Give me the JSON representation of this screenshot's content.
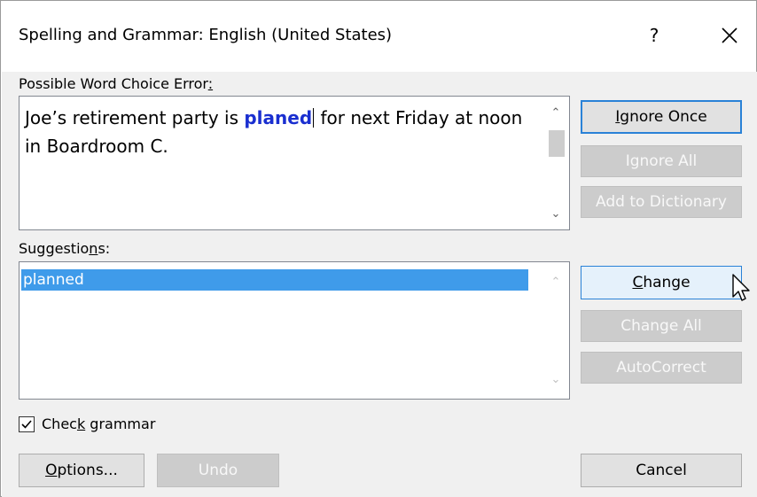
{
  "dialog": {
    "title": "Spelling and Grammar: English (United States)",
    "help_label": "?",
    "close_icon": "close-icon"
  },
  "error_section": {
    "label": "Possible Word Choice Error",
    "label_suffix": ":",
    "sentence_before": "Joe’s retirement party is ",
    "error_word": "planed",
    "sentence_after": " for next Friday at noon in Boardroom C.",
    "highlight_color": "#1a2fd0"
  },
  "suggestions_section": {
    "label_pre": "Suggestio",
    "label_access": "n",
    "label_post": "s:",
    "items": [
      "planned"
    ],
    "selected_color": "#3f9bea"
  },
  "buttons": {
    "ignore_once": {
      "access": "I",
      "rest": "gnore Once"
    },
    "ignore_all": "Ignore All",
    "add_to_dictionary": "Add to Dictionary",
    "change": {
      "access": "C",
      "rest": "hange"
    },
    "change_all": "Change All",
    "autocorrect": "AutoCorrect",
    "options": {
      "access": "O",
      "rest": "ptions..."
    },
    "undo": "Undo",
    "cancel": "Cancel"
  },
  "check_grammar": {
    "checked": true,
    "label_pre": "Chec",
    "label_access": "k",
    "label_post": " grammar"
  }
}
